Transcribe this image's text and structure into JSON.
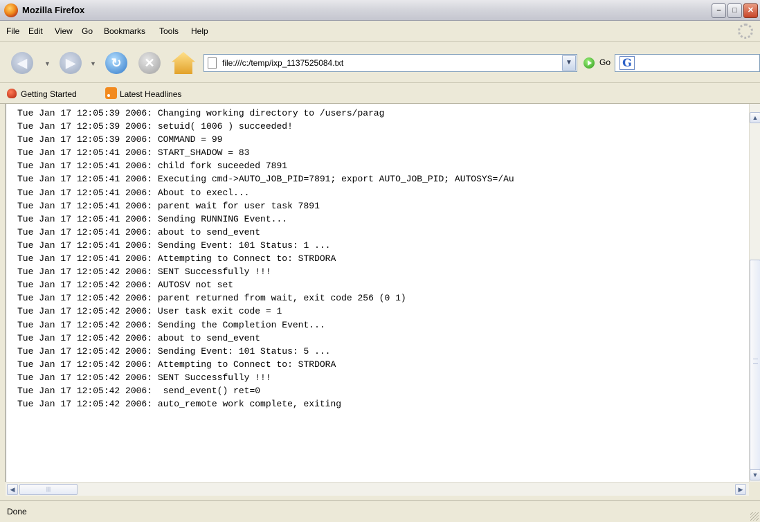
{
  "window": {
    "title": "Mozilla Firefox",
    "minimize": "–",
    "maximize": "□",
    "close": "✕"
  },
  "menu": {
    "items": [
      "File",
      "Edit",
      "View",
      "Go",
      "Bookmarks",
      "Tools",
      "Help"
    ]
  },
  "nav": {
    "back_icon": "back-arrow-icon",
    "forward_icon": "forward-arrow-icon",
    "reload_icon": "reload-icon",
    "stop_icon": "stop-icon",
    "home_icon": "home-icon",
    "url": "file:///c:/temp/ixp_1137525084.txt",
    "go_label": "Go",
    "search_engine_glyph": "G",
    "search_value": ""
  },
  "bookmarks": {
    "items": [
      "Getting Started",
      "Latest Headlines"
    ]
  },
  "log": {
    "lines": [
      "Tue Jan 17 12:05:39 2006: Changing working directory to /users/parag",
      "Tue Jan 17 12:05:39 2006: setuid( 1006 ) succeeded!",
      "Tue Jan 17 12:05:39 2006: COMMAND = 99",
      "Tue Jan 17 12:05:41 2006: START_SHADOW = 83",
      "Tue Jan 17 12:05:41 2006: child fork suceeded 7891",
      "Tue Jan 17 12:05:41 2006: Executing cmd->AUTO_JOB_PID=7891; export AUTO_JOB_PID; AUTOSYS=/Au",
      "Tue Jan 17 12:05:41 2006: About to execl...",
      "Tue Jan 17 12:05:41 2006: parent wait for user task 7891",
      "Tue Jan 17 12:05:41 2006: Sending RUNNING Event...",
      "Tue Jan 17 12:05:41 2006: about to send_event",
      "Tue Jan 17 12:05:41 2006: Sending Event: 101 Status: 1 ...",
      "Tue Jan 17 12:05:41 2006: Attempting to Connect to: STRDORA",
      "Tue Jan 17 12:05:42 2006: SENT Successfully !!!",
      "Tue Jan 17 12:05:42 2006: AUTOSV not set",
      "Tue Jan 17 12:05:42 2006: parent returned from wait, exit code 256 (0 1)",
      "Tue Jan 17 12:05:42 2006: User task exit code = 1",
      "Tue Jan 17 12:05:42 2006: Sending the Completion Event...",
      "Tue Jan 17 12:05:42 2006: about to send_event",
      "Tue Jan 17 12:05:42 2006: Sending Event: 101 Status: 5 ...",
      "Tue Jan 17 12:05:42 2006: Attempting to Connect to: STRDORA",
      "Tue Jan 17 12:05:42 2006: SENT Successfully !!!",
      "Tue Jan 17 12:05:42 2006:  send_event() ret=0",
      "Tue Jan 17 12:05:42 2006: auto_remote work complete, exiting"
    ]
  },
  "scrollbars": {
    "up": "▲",
    "down": "▼",
    "left": "◀",
    "right": "▶",
    "h_grip": "|||"
  },
  "status": {
    "text": "Done"
  },
  "colors": {
    "chrome": "#ece9d8",
    "content_bg": "#ffffff",
    "url_border": "#7f9db9",
    "rss": "#f28a1e"
  }
}
